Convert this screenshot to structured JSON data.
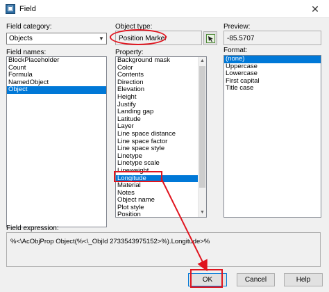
{
  "window": {
    "title": "Field",
    "close_label": "✕"
  },
  "field_category": {
    "label": "Field category:",
    "value": "Objects"
  },
  "field_names": {
    "label": "Field names:",
    "items": [
      "BlockPlaceholder",
      "Count",
      "Formula",
      "NamedObject",
      "Object"
    ],
    "selected_index": 4
  },
  "object_type": {
    "label": "Object type:",
    "value": "Position Marker"
  },
  "property": {
    "label": "Property:",
    "items": [
      "Background mask",
      "Color",
      "Contents",
      "Direction",
      "Elevation",
      "Height",
      "Justify",
      "Landing gap",
      "Latitude",
      "Layer",
      "Line space distance",
      "Line space factor",
      "Line space style",
      "Linetype",
      "Linetype scale",
      "Lineweight",
      "Longitude",
      "Material",
      "Notes",
      "Object name",
      "Plot style",
      "Position"
    ],
    "selected_index": 16
  },
  "preview": {
    "label": "Preview:",
    "value": "-85.5707"
  },
  "format": {
    "label": "Format:",
    "items": [
      "(none)",
      "Uppercase",
      "Lowercase",
      "First capital",
      "Title case"
    ],
    "selected_index": 0
  },
  "field_expression": {
    "label": "Field expression:",
    "value": "%<\\AcObjProp Object(%<\\_ObjId 2733543975152>%).Longitude>%"
  },
  "buttons": {
    "ok": "OK",
    "cancel": "Cancel",
    "help": "Help"
  },
  "colors": {
    "selection": "#0078d7",
    "annotation": "#e0141e"
  }
}
